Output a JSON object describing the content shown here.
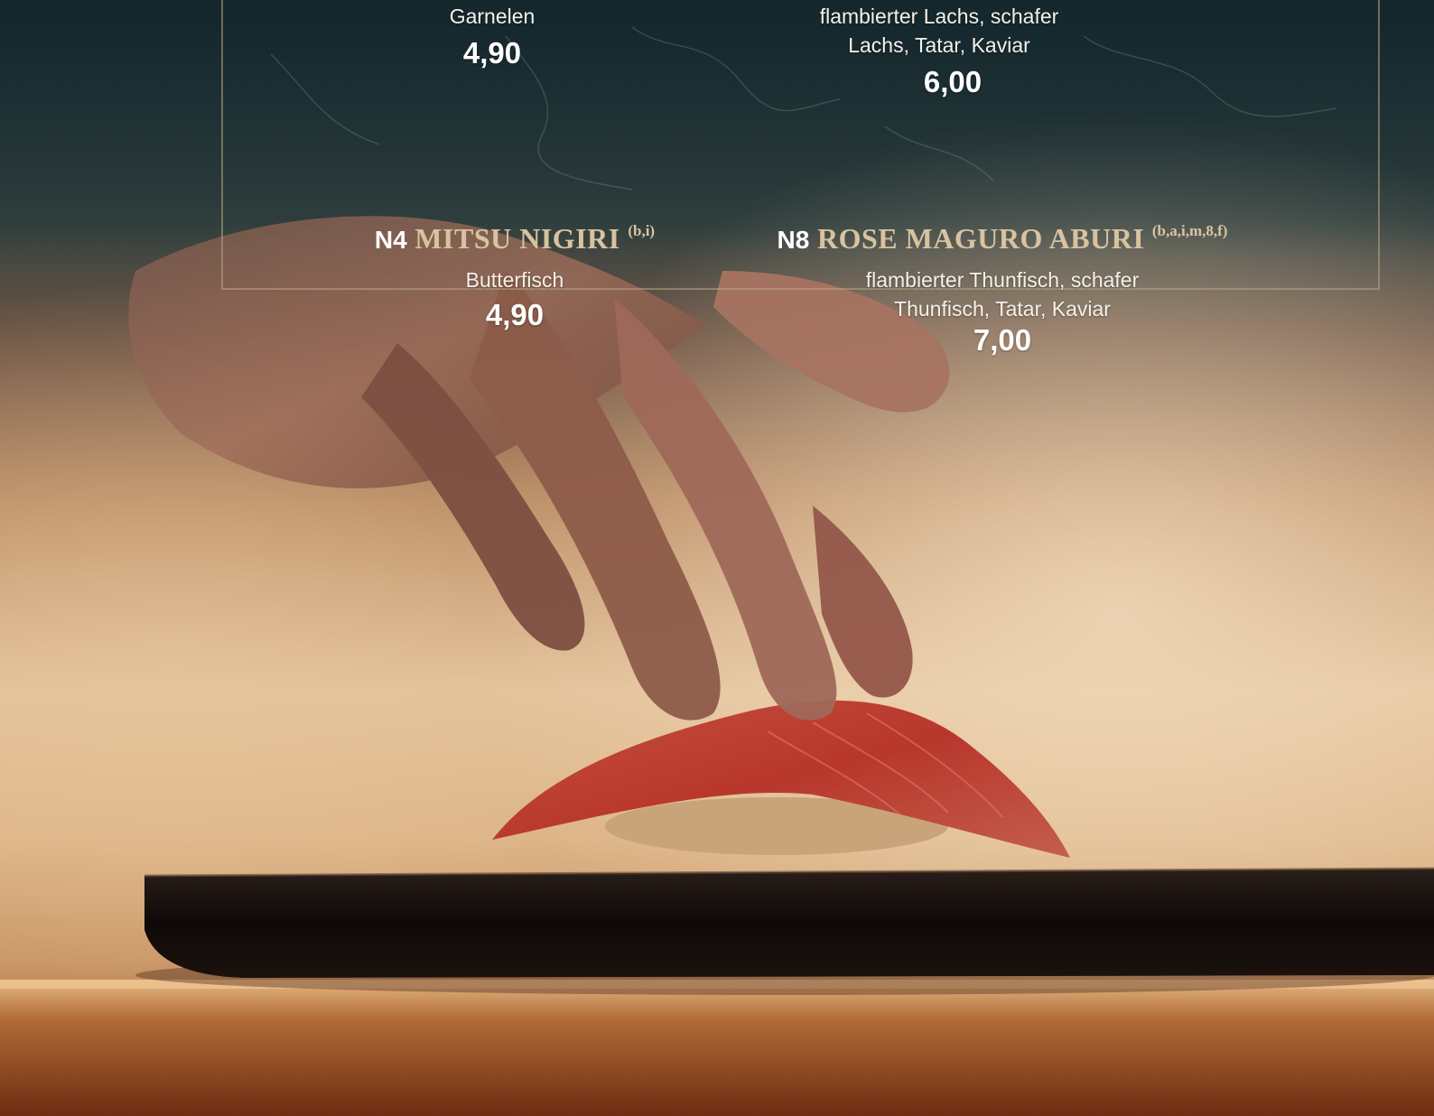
{
  "menu": {
    "items": [
      {
        "code": "",
        "name": "",
        "allergens": "",
        "description": "Garnelen",
        "price": "4,90"
      },
      {
        "code": "",
        "name": "",
        "allergens": "",
        "description": "flambierter Lachs, schafer Lachs, Tatar, Kaviar",
        "price": "6,00"
      },
      {
        "code": "N4",
        "name": "MITSU NIGIRI",
        "allergens": "(b,i)",
        "description": "Butterfisch",
        "price": "4,90"
      },
      {
        "code": "N8",
        "name": "ROSE MAGURO ABURI",
        "allergens": "(b,a,i,m,8,f)",
        "description": "flambierter Thunfisch, schafer Thunfisch, Tatar, Kaviar",
        "price": "7,00"
      }
    ]
  },
  "colors": {
    "accent_gold": "#d8c3a0",
    "marble_dark": "#2a3a3d",
    "wood_warm": "#b8753f"
  }
}
